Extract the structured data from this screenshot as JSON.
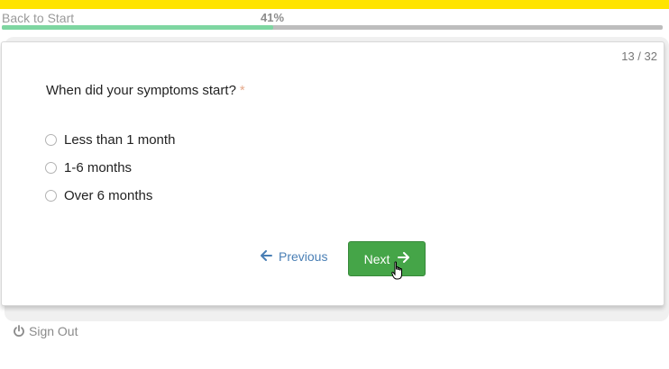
{
  "header": {
    "back_label": "Back to Start",
    "progress_percent_label": "41%",
    "progress_fraction": 0.41
  },
  "question": {
    "counter": "13 / 32",
    "text": "When did your symptoms start?",
    "required_mark": "*",
    "options": [
      {
        "label": "Less than 1 month"
      },
      {
        "label": "1-6 months"
      },
      {
        "label": "Over 6 months"
      }
    ]
  },
  "navigation": {
    "previous_label": "Previous",
    "next_label": "Next"
  },
  "footer": {
    "signout_label": "Sign Out"
  },
  "colors": {
    "top_bar": "#ffe400",
    "progress_fill": "#7ed6a1",
    "next_button": "#45a548",
    "previous_link": "#4a7fb5",
    "required_mark": "#e6a98b"
  },
  "icons": {
    "previous": "arrow-left-icon",
    "next": "arrow-right-icon",
    "signout": "power-icon",
    "cursor": "hand-pointer-icon"
  }
}
